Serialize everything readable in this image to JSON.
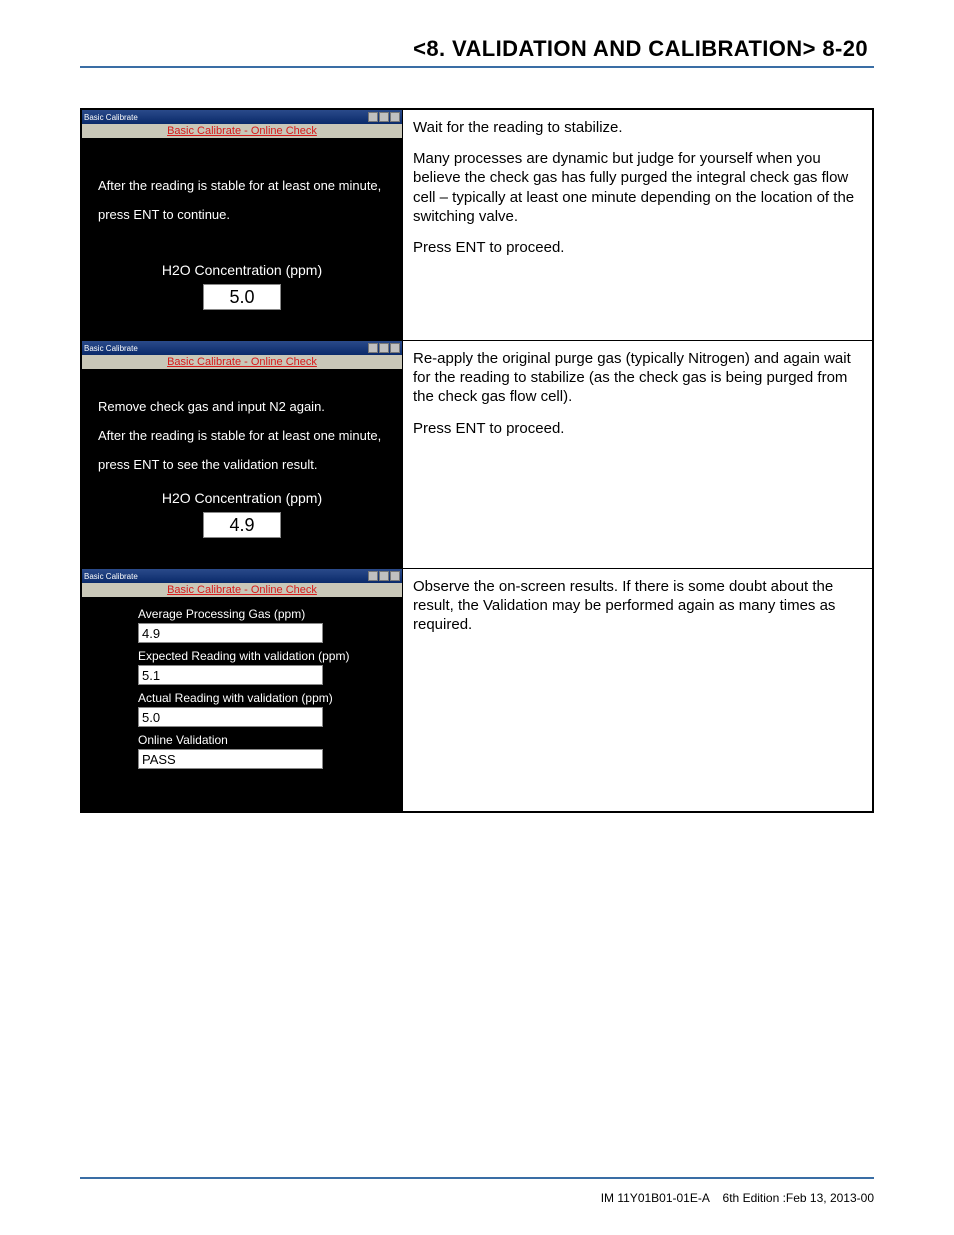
{
  "header": {
    "title": "<8. VALIDATION AND CALIBRATION>  8-20"
  },
  "win_title": "Basic Calibrate",
  "win_subtitle": "Basic Calibrate - Online Check",
  "rows": [
    {
      "panel": {
        "lines": [
          "After the reading is stable for at least one minute,",
          "press ENT to continue."
        ],
        "center_label": "H2O Concentration (ppm)",
        "value": "5.0"
      },
      "instr": [
        "Wait for the reading to stabilize.",
        "Many processes are dynamic but judge for yourself when you believe the check gas has fully purged the integral check gas flow cell – typically at least one minute depending on the location of the switching valve.",
        "Press ENT to proceed."
      ]
    },
    {
      "panel": {
        "lines": [
          "Remove check gas and input N2 again.",
          "After the reading is stable for at least one minute,",
          "press ENT to see the validation result."
        ],
        "center_label": "H2O Concentration (ppm)",
        "value": "4.9"
      },
      "instr": [
        "Re-apply the original purge gas (typically Nitrogen) and again wait for the reading to stabilize (as the check gas is being purged from the check gas flow cell).",
        "Press ENT to proceed."
      ]
    },
    {
      "panel": {
        "results": [
          {
            "label": "Average Processing Gas (ppm)",
            "value": "4.9"
          },
          {
            "label": "Expected Reading with validation (ppm)",
            "value": "5.1"
          },
          {
            "label": "Actual Reading with validation (ppm)",
            "value": "5.0"
          },
          {
            "label": "Online Validation",
            "value": "PASS"
          }
        ]
      },
      "instr": [
        "Observe the on-screen results. If there is some doubt about the result, the Validation may be performed again as many times as required."
      ]
    }
  ],
  "footer": {
    "left": "IM 11Y01B01-01E-A",
    "right": "6th Edition :Feb 13, 2013-00"
  }
}
